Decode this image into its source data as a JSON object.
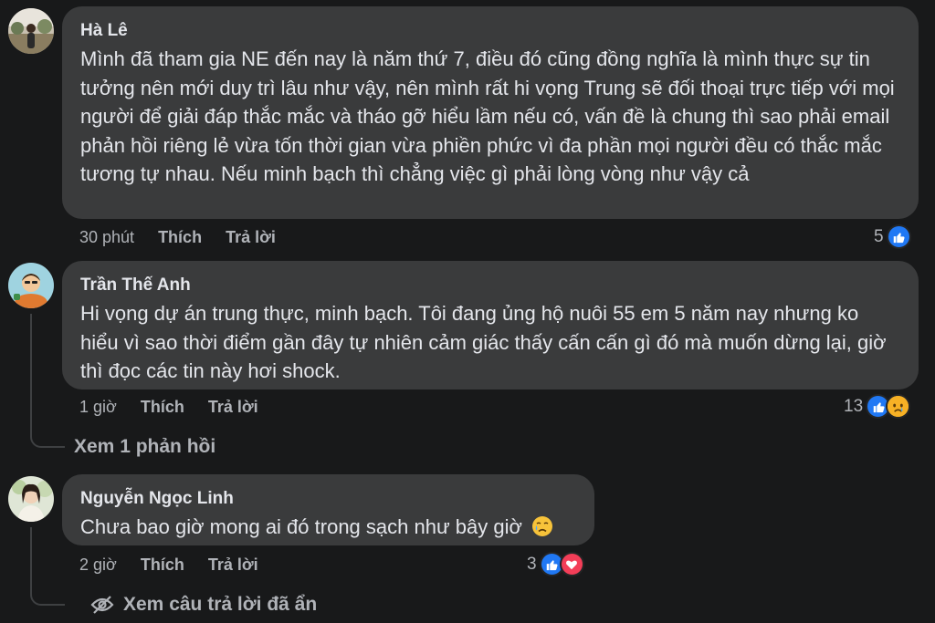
{
  "comments": [
    {
      "author": "Hà Lê",
      "text": "Mình đã tham gia NE đến nay là năm thứ 7, điều đó cũng đồng nghĩa là mình thực sự tin tưởng nên mới duy trì lâu như vậy, nên mình rất hi vọng Trung sẽ đối thoại trực tiếp với mọi người để giải đáp thắc mắc và tháo gỡ hiểu lầm nếu có, vấn đề là chung thì sao phải email phản hồi riêng lẻ vừa tốn thời gian vừa phiền phức vì đa phần mọi người đều có thắc mắc tương tự nhau. Nếu minh bạch thì chẳng việc gì phải lòng vòng như vậy cả",
      "time": "30 phút",
      "like_label": "Thích",
      "reply_label": "Trả lời",
      "reaction_count": "5",
      "reactions": [
        "like"
      ]
    },
    {
      "author": "Trần Thế Anh",
      "text": "Hi vọng dự án trung thực, minh bạch. Tôi đang ủng hộ nuôi 55 em 5 năm nay nhưng ko hiểu vì sao thời điểm gần đây tự nhiên cảm giác thấy cấn cấn gì đó mà muốn dừng lại, giờ thì đọc các tin này hơi shock.",
      "time": "1 giờ",
      "like_label": "Thích",
      "reply_label": "Trả lời",
      "reaction_count": "13",
      "reactions": [
        "like",
        "sad"
      ],
      "view_replies": "Xem 1 phản hồi"
    },
    {
      "author": "Nguyễn Ngọc Linh",
      "text": "Chưa bao giờ mong ai đó trong sạch như bây giờ",
      "text_emoji": "sad-tear-emoji",
      "time": "2 giờ",
      "like_label": "Thích",
      "reply_label": "Trả lời",
      "reaction_count": "3",
      "reactions": [
        "like",
        "love"
      ],
      "hidden_replies": "Xem câu trả lời đã ẩn"
    }
  ],
  "colors": {
    "background": "#18191a",
    "bubble": "#3a3b3c",
    "text": "#e4e6eb",
    "secondary": "#b0b3b8",
    "like": "#2078f4",
    "love": "#f33e58",
    "sad": "#f7b125"
  }
}
